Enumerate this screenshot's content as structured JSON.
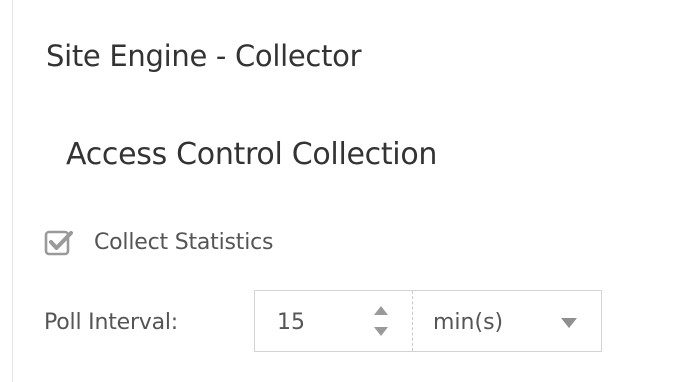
{
  "panel": {
    "title": "Site Engine - Collector"
  },
  "section": {
    "title": "Access Control Collection"
  },
  "collect_statistics": {
    "label": "Collect Statistics",
    "checked": true
  },
  "poll_interval": {
    "label": "Poll Interval:",
    "value": "15",
    "unit": "min(s)"
  },
  "icons": {
    "checkbox": "checkbox-checked-icon",
    "spinner": "spinner-up-down-icon",
    "dropdown": "caret-down-icon"
  },
  "colors": {
    "text": "#333333",
    "muted_text": "#555555",
    "border": "#d3d3d3",
    "icon": "#9a9a9a"
  }
}
